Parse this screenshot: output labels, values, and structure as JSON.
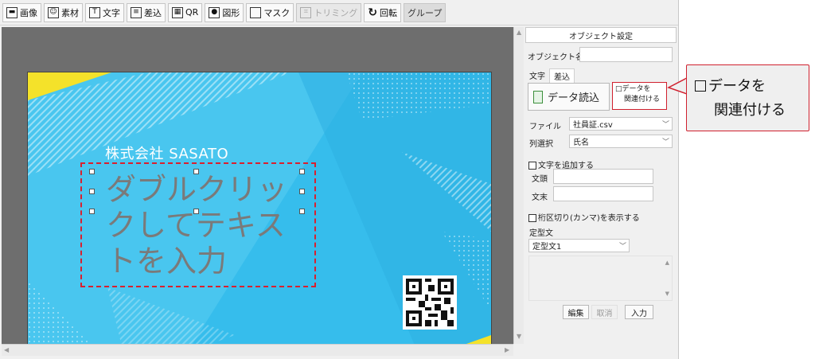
{
  "toolbar": {
    "items": [
      {
        "label": "画像",
        "icon": "image-icon"
      },
      {
        "label": "素材",
        "icon": "material-icon"
      },
      {
        "label": "文字",
        "icon": "text-icon"
      },
      {
        "label": "差込",
        "icon": "merge-icon"
      },
      {
        "label": "QR",
        "icon": "qr-icon"
      },
      {
        "label": "図形",
        "icon": "shape-icon"
      },
      {
        "label": "マスク",
        "icon": "mask-icon"
      },
      {
        "label": "トリミング",
        "icon": "crop-icon",
        "disabled": true
      },
      {
        "label": "回転",
        "icon": "rotate-icon"
      },
      {
        "label": "グループ",
        "icon": ""
      }
    ]
  },
  "card": {
    "company": "株式会社 SASATO",
    "textbox_text": "ダブルクリックしてテキストを入力",
    "background_color": "#36bdec",
    "accent_color": "#f4e22a"
  },
  "panel": {
    "title": "オブジェクト設定",
    "object_name_label": "オブジェクト名",
    "object_name_value": "",
    "tab_text": "文字",
    "tab_merge": "差込",
    "data_load_label": "データ読込",
    "link_data_label_line1": "□データを",
    "link_data_label_line2": "関連付ける",
    "file_label": "ファイル",
    "file_value": "社員証.csv",
    "column_label": "列選択",
    "column_value": "氏名",
    "add_text_label": "文字を追加する",
    "prefix_label": "文頭",
    "suffix_label": "文末",
    "separator_label": "桁区切り(カンマ)を表示する",
    "template_label": "定型文",
    "template_value": "定型文1",
    "edit_button": "編集",
    "cancel_button": "取消",
    "input_button": "入力"
  },
  "callout": {
    "line1": "データを",
    "line2": "関連付ける",
    "border_color": "#d0202e"
  }
}
